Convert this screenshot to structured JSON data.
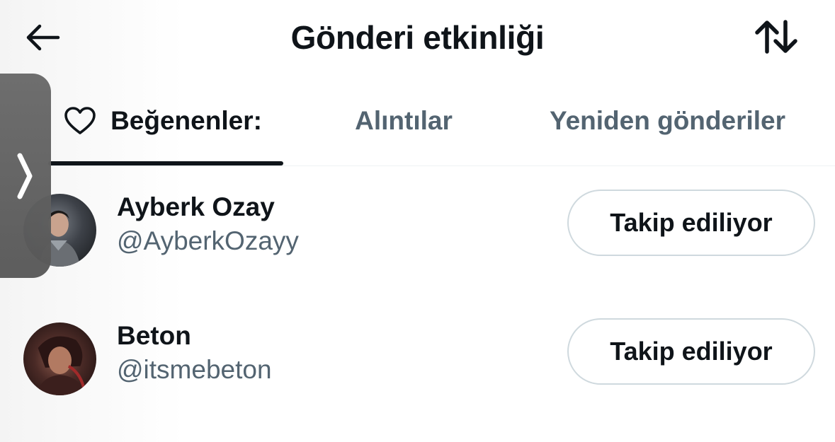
{
  "header": {
    "title": "Gönderi etkinliği",
    "back_icon": "arrow-left-icon",
    "sort_icon": "sort-arrows-icon"
  },
  "tabs": [
    {
      "label": "Beğenenler:",
      "icon": "heart-outline-icon",
      "selected": true
    },
    {
      "label": "Alıntılar",
      "selected": false
    },
    {
      "label": "Yeniden gönderiler",
      "selected": false
    }
  ],
  "users": [
    {
      "name": "Ayberk Ozay",
      "handle": "@AyberkOzayy",
      "follow_label": "Takip ediliyor"
    },
    {
      "name": "Beton",
      "handle": "@itsmebeton",
      "follow_label": "Takip ediliyor"
    }
  ],
  "side_handle": {
    "icon": "chevron-right-icon"
  },
  "colors": {
    "text_primary": "#0f1419",
    "text_secondary": "#536471",
    "border": "#cfd9de"
  }
}
